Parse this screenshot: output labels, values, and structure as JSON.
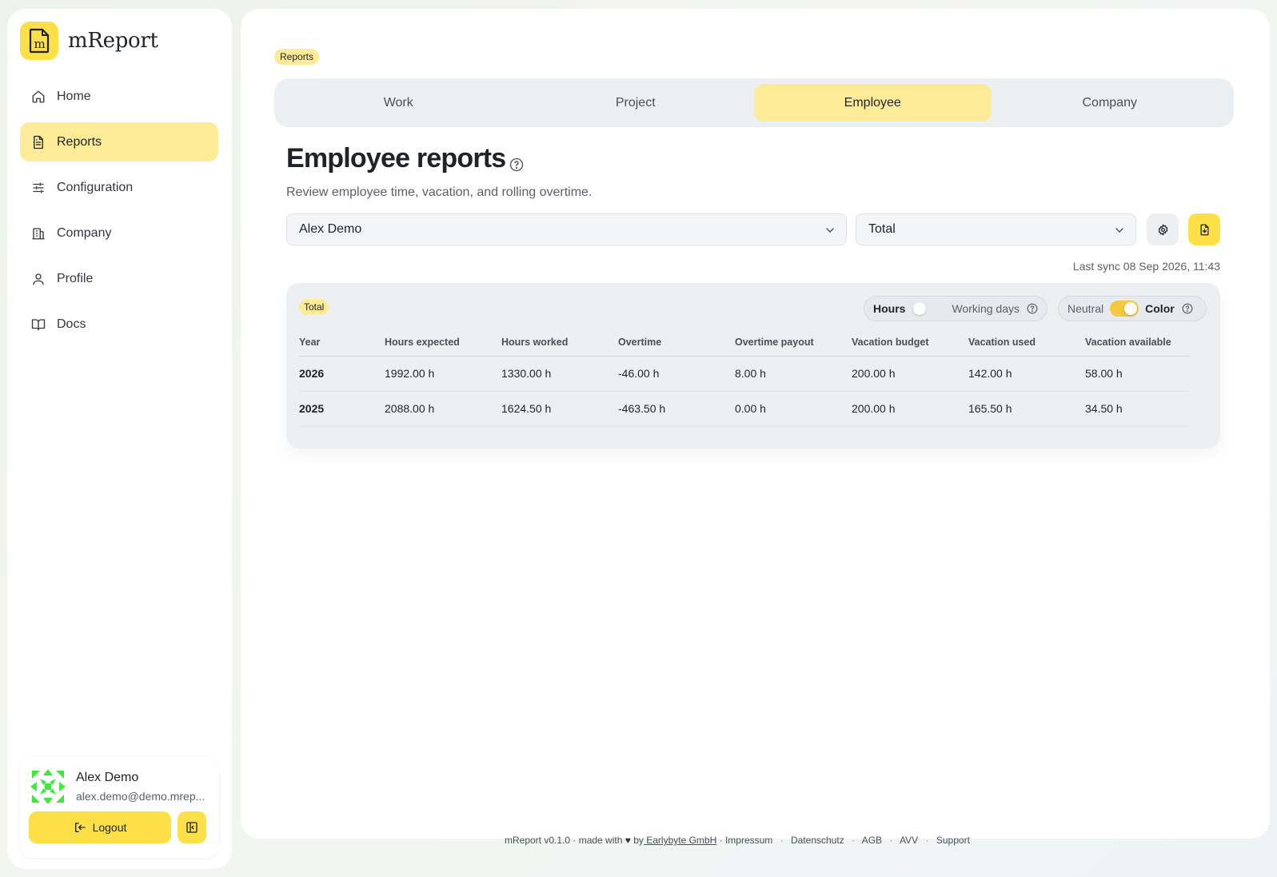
{
  "app": {
    "name": "mReport",
    "logo_letter": "m",
    "accent": "#fde047",
    "accent_soft": "#fdeb98"
  },
  "sidebar": {
    "items": [
      {
        "label": "Home",
        "icon": "home-icon"
      },
      {
        "label": "Reports",
        "icon": "report-icon",
        "active": true
      },
      {
        "label": "Configuration",
        "icon": "sliders-icon"
      },
      {
        "label": "Company",
        "icon": "building-icon"
      },
      {
        "label": "Profile",
        "icon": "user-icon"
      },
      {
        "label": "Docs",
        "icon": "book-icon"
      }
    ]
  },
  "user": {
    "name": "Alex Demo",
    "email": "alex.demo@demo.mrep...",
    "logout_label": "Logout"
  },
  "breadcrumb": "Reports",
  "tabs": [
    {
      "label": "Work"
    },
    {
      "label": "Project"
    },
    {
      "label": "Employee",
      "active": true
    },
    {
      "label": "Company"
    }
  ],
  "page": {
    "title": "Employee reports",
    "subtitle": "Review employee time, vacation, and rolling overtime.",
    "employee_select": "Alex Demo",
    "period_select": "Total",
    "last_sync": "Last sync 08 Sep 2026, 11:43"
  },
  "report": {
    "badge": "Total",
    "unit_toggle": {
      "left": "Hours",
      "right": "Working days",
      "selected": "Hours"
    },
    "color_toggle": {
      "left": "Neutral",
      "right": "Color",
      "selected": "Color"
    },
    "columns": [
      "Year",
      "Hours expected",
      "Hours worked",
      "Overtime",
      "Overtime payout",
      "Vacation budget",
      "Vacation used",
      "Vacation available"
    ],
    "rows": [
      {
        "year": "2026",
        "expected": "1992.00 h",
        "worked": "1330.00 h",
        "overtime": "-46.00 h",
        "payout": "8.00 h",
        "budget": "200.00 h",
        "used": "142.00 h",
        "available": "58.00 h"
      },
      {
        "year": "2025",
        "expected": "2088.00 h",
        "worked": "1624.50 h",
        "overtime": "-463.50 h",
        "payout": "0.00 h",
        "budget": "200.00 h",
        "used": "165.50 h",
        "available": "34.50 h"
      }
    ],
    "colors": {
      "negative": "#c81e1e",
      "warning": "#c2600e"
    }
  },
  "footer": {
    "version": "mReport v0.1.0 · made with",
    "by": "by",
    "company": " Earlybyte GmbH",
    "links": [
      "Impressum",
      "Datenschutz",
      "AGB",
      "AVV",
      "Support"
    ]
  }
}
